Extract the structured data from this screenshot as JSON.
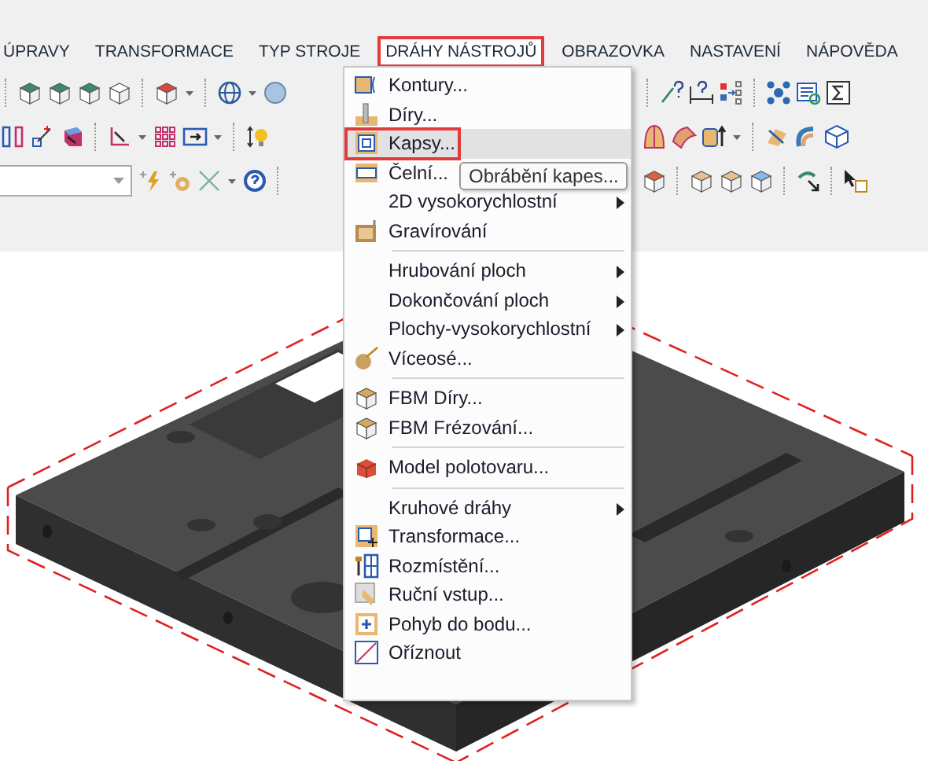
{
  "menu_bar": [
    {
      "label": "ÚPRAVY",
      "selected": false
    },
    {
      "label": "TRANSFORMACE",
      "selected": false
    },
    {
      "label": "TYP STROJE",
      "selected": false
    },
    {
      "label": "DRÁHY NÁSTROJŮ",
      "selected": true
    },
    {
      "label": "OBRAZOVKA",
      "selected": false
    },
    {
      "label": "NASTAVENÍ",
      "selected": false
    },
    {
      "label": "NÁPOVĚDA",
      "selected": false
    }
  ],
  "dropdown": {
    "items": [
      {
        "kind": "item",
        "label": "Kontury...",
        "selected": false
      },
      {
        "kind": "item",
        "label": "Díry...",
        "selected": false
      },
      {
        "kind": "item",
        "label": "Kapsy...",
        "selected": true
      },
      {
        "kind": "item",
        "label": "Čelní...",
        "selected": false
      },
      {
        "kind": "submenu",
        "label": "2D vysokorychlostní",
        "selected": false
      },
      {
        "kind": "item",
        "label": "Gravírování",
        "selected": false
      },
      {
        "kind": "separator"
      },
      {
        "kind": "submenu",
        "label": "Hrubování ploch",
        "selected": false
      },
      {
        "kind": "submenu",
        "label": "Dokončování ploch",
        "selected": false
      },
      {
        "kind": "submenu",
        "label": "Plochy-vysokorychlostní",
        "selected": false
      },
      {
        "kind": "item",
        "label": "Víceosé...",
        "selected": false
      },
      {
        "kind": "separator"
      },
      {
        "kind": "item",
        "label": "FBM Díry...",
        "selected": false
      },
      {
        "kind": "item",
        "label": "FBM Frézování...",
        "selected": false
      },
      {
        "kind": "separator"
      },
      {
        "kind": "item",
        "label": "Model polotovaru...",
        "selected": false
      },
      {
        "kind": "separator"
      },
      {
        "kind": "submenu",
        "label": "Kruhové dráhy",
        "selected": false
      },
      {
        "kind": "item",
        "label": "Transformace...",
        "selected": false
      },
      {
        "kind": "item",
        "label": "Rozmístění...",
        "selected": false
      },
      {
        "kind": "item",
        "label": "Ruční vstup...",
        "selected": false
      },
      {
        "kind": "item",
        "label": "Pohyb do bodu...",
        "selected": false
      },
      {
        "kind": "item",
        "label": "Oříznout",
        "selected": false
      }
    ]
  },
  "tooltip": {
    "text": "Obrábění kapes..."
  }
}
